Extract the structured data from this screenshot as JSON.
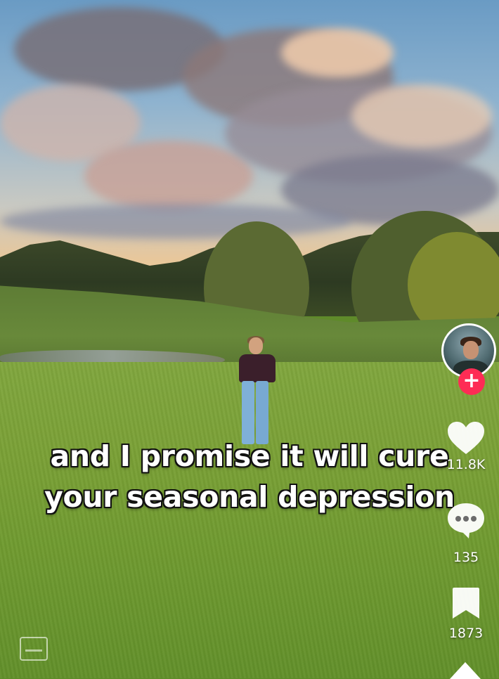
{
  "caption": {
    "line1": "and I promise it will cure",
    "line2": "your seasonal depression"
  },
  "actions": {
    "likes": "11.8K",
    "comments": "135",
    "saves": "1873"
  },
  "icons": {
    "like": "heart-icon",
    "comment": "comment-bubble-icon",
    "save": "bookmark-icon",
    "share": "share-arrow-icon",
    "follow": "plus-icon",
    "captions": "closed-caption-icon"
  },
  "follow_glyph": "+",
  "colors": {
    "follow": "#fe2c55",
    "text": "#ffffff"
  }
}
